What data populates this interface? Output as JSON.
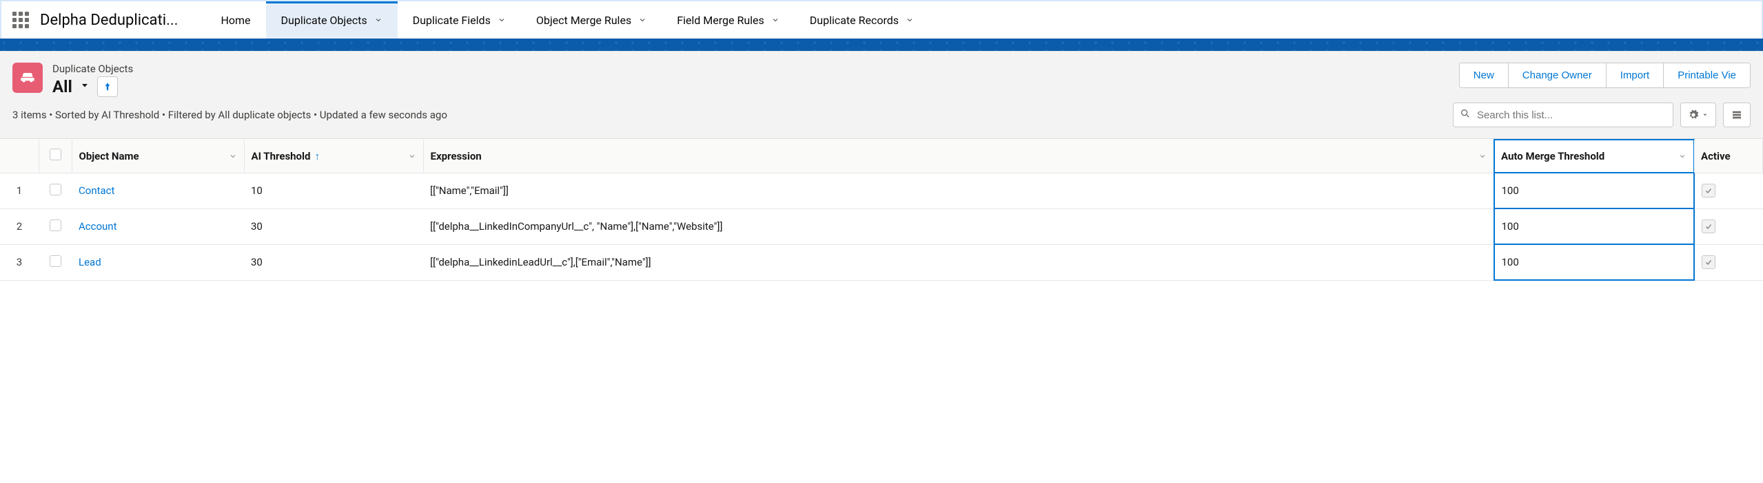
{
  "app_name": "Delpha Deduplicati...",
  "nav": {
    "home": "Home",
    "duplicate_objects": "Duplicate Objects",
    "duplicate_fields": "Duplicate Fields",
    "object_merge_rules": "Object Merge Rules",
    "field_merge_rules": "Field Merge Rules",
    "duplicate_records": "Duplicate Records"
  },
  "page_header": {
    "breadcrumb": "Duplicate Objects",
    "list_name": "All",
    "meta": "3 items • Sorted by AI Threshold • Filtered by All duplicate objects • Updated a few seconds ago"
  },
  "actions": {
    "new": "New",
    "change_owner": "Change Owner",
    "import": "Import",
    "printable_view": "Printable Vie"
  },
  "search": {
    "placeholder": "Search this list..."
  },
  "columns": {
    "object_name": "Object Name",
    "ai_threshold": "AI Threshold",
    "expression": "Expression",
    "auto_merge_threshold": "Auto Merge Threshold",
    "active": "Active"
  },
  "sort_indicator": "↑",
  "rows": [
    {
      "num": "1",
      "object_name": "Contact",
      "ai_threshold": "10",
      "expression": "[[\"Name\",\"Email\"]]",
      "auto_merge": "100",
      "active": true
    },
    {
      "num": "2",
      "object_name": "Account",
      "ai_threshold": "30",
      "expression": "[[\"delpha__LinkedInCompanyUrl__c\", \"Name\"],[\"Name\",\"Website\"]]",
      "auto_merge": "100",
      "active": true
    },
    {
      "num": "3",
      "object_name": "Lead",
      "ai_threshold": "30",
      "expression": "[[\"delpha__LinkedinLeadUrl__c\"],[\"Email\",\"Name\"]]",
      "auto_merge": "100",
      "active": true
    }
  ]
}
